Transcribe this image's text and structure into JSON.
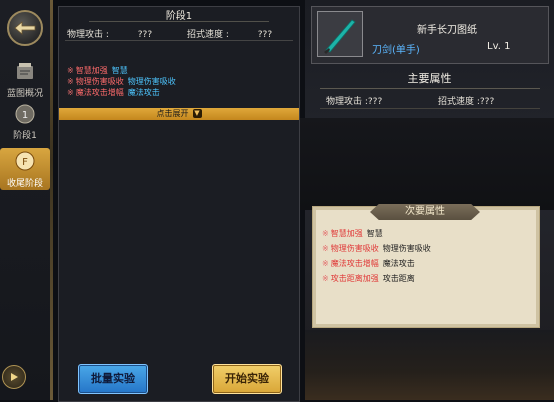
{
  "nav": {
    "items": [
      {
        "label": "蓝图概况",
        "icon": "blueprint-icon"
      },
      {
        "label": "阶段1",
        "icon": "stage-icon"
      },
      {
        "label": "收尾阶段",
        "icon": "final-stage-icon",
        "badge": "F"
      }
    ]
  },
  "stage": {
    "title": "阶段1",
    "stats": [
      {
        "label": "物理攻击 :",
        "value": "???"
      },
      {
        "label": "招式速度 :",
        "value": "???"
      }
    ],
    "attrs": [
      {
        "name": "智慧加强",
        "desc": "智慧"
      },
      {
        "name": "物理伤害吸收",
        "desc": "物理伤害吸收"
      },
      {
        "name": "魔法攻击增幅",
        "desc": "魔法攻击"
      }
    ],
    "expand_label": "点击展开",
    "batch_button": "批量实验",
    "start_button": "开始实验"
  },
  "item": {
    "name": "新手长刀图纸",
    "type": "刀剑(单手)",
    "level": "Lv. 1"
  },
  "main_attrs": {
    "title": "主要属性",
    "stats": [
      {
        "label": "物理攻击 :",
        "value": "???"
      },
      {
        "label": "招式速度 :",
        "value": "???"
      }
    ]
  },
  "secondary": {
    "title": "次要属性",
    "attrs": [
      {
        "name": "智慧加强",
        "desc": "智慧"
      },
      {
        "name": "物理伤害吸收",
        "desc": "物理伤害吸收"
      },
      {
        "name": "魔法攻击增幅",
        "desc": "魔法攻击"
      },
      {
        "name": "攻击距离加强",
        "desc": "攻击距离"
      }
    ]
  },
  "colors": {
    "accent_gold": "#e0a83a",
    "attr_name_red": "#ff6b6b",
    "attr_desc_cyan": "#4ec6ff",
    "item_type_blue": "#5cb7ff"
  }
}
